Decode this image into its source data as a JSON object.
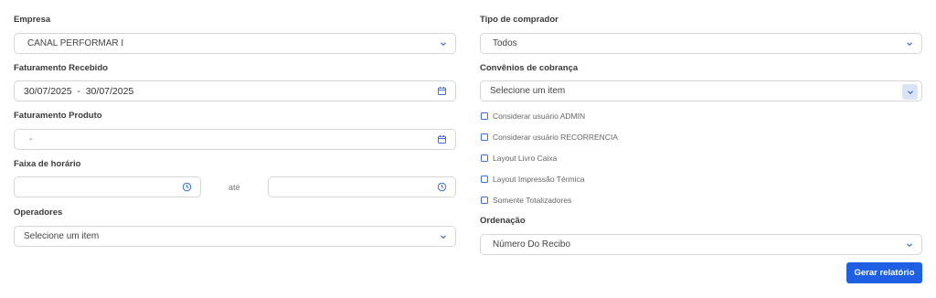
{
  "left": {
    "empresa": {
      "label": "Empresa",
      "value": "CANAL PERFORMAR I"
    },
    "faturamento_recebido": {
      "label": "Faturamento Recebido",
      "value": "30/07/2025  -  30/07/2025"
    },
    "faturamento_produto": {
      "label": "Faturamento Produto",
      "value": "-"
    },
    "faixa_horario": {
      "label": "Faixa de horário",
      "separator": "até",
      "start": "",
      "end": ""
    },
    "operadores": {
      "label": "Operadores",
      "placeholder": "Selecione um item"
    }
  },
  "right": {
    "tipo_comprador": {
      "label": "Tipo de comprador",
      "value": "Todos"
    },
    "convenios": {
      "label": "Convênios de cobrança",
      "placeholder": "Selecione um item"
    },
    "checkboxes": [
      {
        "label": "Considerar usuário ADMIN",
        "checked": false
      },
      {
        "label": "Considerar usuário RECORRENCIA",
        "checked": false
      },
      {
        "label": "Layout Livro Caixa",
        "checked": false
      },
      {
        "label": "Layout Impressão Térmica",
        "checked": false
      },
      {
        "label": "Somente Totalizadores",
        "checked": false
      }
    ],
    "ordenacao": {
      "label": "Ordenação",
      "value": "Número Do Recibo"
    }
  },
  "actions": {
    "submit_label": "Gerar relatório"
  },
  "colors": {
    "accent": "#1e5fe3",
    "border": "#d6d6d6",
    "icon": "#3b6fd9"
  },
  "icons": {
    "dropdown": "chevron-down-icon",
    "date": "calendar-icon",
    "time": "clock-icon"
  }
}
